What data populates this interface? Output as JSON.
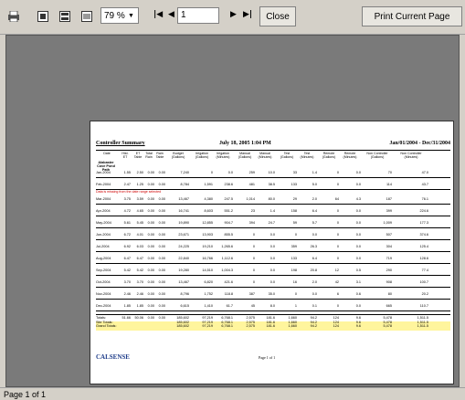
{
  "toolbar": {
    "zoom_value": "79 %",
    "page_value": "1",
    "close_label": "Close",
    "print_label": "Print Current Page"
  },
  "status_text": "Page 1 of 1",
  "report": {
    "title": "Controller Summary",
    "date_time": "July 18, 2005 1:04 PM",
    "range": "Jan/01/2004 - Dec/31/2004",
    "site": "Alabaster Cove Pond Path",
    "warning": "Data is missing from the date range selected",
    "columns": [
      "Date",
      "Hist. ET",
      "ET Table",
      "Total Rain",
      "Rain Table",
      "Budget (Gallons)",
      "Irrigation (Gallons)",
      "Irrigation (Minutes)",
      "Manual (Gallons)",
      "Manual (Minutes)",
      "Test (Gallons)",
      "Test (Minutes)",
      "Remote (Gallons)",
      "Remote (Minutes)",
      "Non Controller (Gallons)",
      "Non Controller (Minutes)"
    ],
    "rows": [
      [
        "Jan-2004",
        "1.55",
        "2.50",
        "0.00",
        "0.00",
        "7,240",
        "0",
        "0.0",
        "259",
        "10.0",
        "33",
        "1.4",
        "0",
        "0.0",
        "70",
        "47.0"
      ],
      [
        "Feb-2004",
        "2.47",
        "1.25",
        "0.00",
        "0.00",
        "8,784",
        "1,591",
        "238.6",
        "481",
        "38.5",
        "133",
        "5.0",
        "0",
        "0.0",
        "114",
        "43.7"
      ],
      [
        "Mar-2004",
        "3.75",
        "3.59",
        "0.00",
        "0.00",
        "13,467",
        "4,380",
        "247.5",
        "1,014",
        "80.0",
        "29",
        "2.0",
        "64",
        "4.3",
        "187",
        "76.1"
      ],
      [
        "Apr-2004",
        "4.72",
        "4.65",
        "0.00",
        "0.00",
        "16,741",
        "8,603",
        "551.2",
        "23",
        "1.4",
        "158",
        "6.4",
        "0",
        "0.0",
        "399",
        "224.6"
      ],
      [
        "May-2004",
        "5.61",
        "5.45",
        "0.00",
        "0.00",
        "19,890",
        "12,855",
        "904.7",
        "394",
        "24.7",
        "59",
        "5.7",
        "0",
        "0.0",
        "1,009",
        "177.3"
      ],
      [
        "Jun-2004",
        "6.72",
        "4.01",
        "0.00",
        "0.00",
        "23,671",
        "13,903",
        "855.5",
        "0",
        "0.0",
        "0",
        "0.0",
        "0",
        "0.0",
        "507",
        "374.6"
      ],
      [
        "Jul-2004",
        "6.92",
        "6.03",
        "0.00",
        "0.00",
        "24,225",
        "19,210",
        "1,265.6",
        "0",
        "0.0",
        "359",
        "26.3",
        "0",
        "0.0",
        "304",
        "125.4"
      ],
      [
        "Aug-2004",
        "6.47",
        "6.47",
        "0.00",
        "0.00",
        "22,840",
        "16,766",
        "1,112.6",
        "0",
        "0.0",
        "133",
        "6.4",
        "0",
        "0.0",
        "719",
        "128.6"
      ],
      [
        "Sep-2004",
        "5.42",
        "5.42",
        "0.00",
        "0.00",
        "19,280",
        "14,510",
        "1,004.3",
        "0",
        "0.0",
        "198",
        "20.8",
        "12",
        "0.5",
        "290",
        "77.4"
      ],
      [
        "Oct-2004",
        "3.70",
        "3.70",
        "0.00",
        "0.00",
        "13,467",
        "6,820",
        "421.6",
        "0",
        "0.0",
        "16",
        "2.0",
        "42",
        "3.1",
        "908",
        "100.7"
      ],
      [
        "Nov-2004",
        "2.46",
        "2.46",
        "0.00",
        "0.00",
        "8,796",
        "1,752",
        "118.8",
        "387",
        "35.0",
        "0",
        "0.0",
        "6",
        "0.6",
        "80",
        "20.2"
      ],
      [
        "Dec-2004",
        "1.85",
        "1.85",
        "0.00",
        "0.00",
        "6,615",
        "1,410",
        "61.7",
        "45",
        "8.0",
        "1",
        "0.1",
        "0",
        "0.0",
        "665",
        "110.7"
      ]
    ],
    "totals": [
      "Totals:",
      "51.66",
      "50.06",
      "0.00",
      "0.00",
      "185,602",
      "97,219",
      "6,768.1",
      "2,575",
      "181.6",
      "1,660",
      "94.2",
      "124",
      "9.6",
      "5,478",
      "1,511.5"
    ],
    "site_totals": [
      "Site Totals:",
      "",
      "",
      "",
      "",
      "185,602",
      "97,219",
      "6,768.1",
      "2,575",
      "181.6",
      "1,660",
      "94.2",
      "124",
      "9.6",
      "5,478",
      "1,511.5"
    ],
    "grand_totals": [
      "Grand Totals:",
      "",
      "",
      "",
      "",
      "185,602",
      "97,219",
      "6,768.1",
      "2,575",
      "181.6",
      "1,660",
      "94.2",
      "124",
      "9.6",
      "5,478",
      "1,511.5"
    ],
    "logo": "CALSENSE",
    "page_label": "Page 1 of 1"
  }
}
